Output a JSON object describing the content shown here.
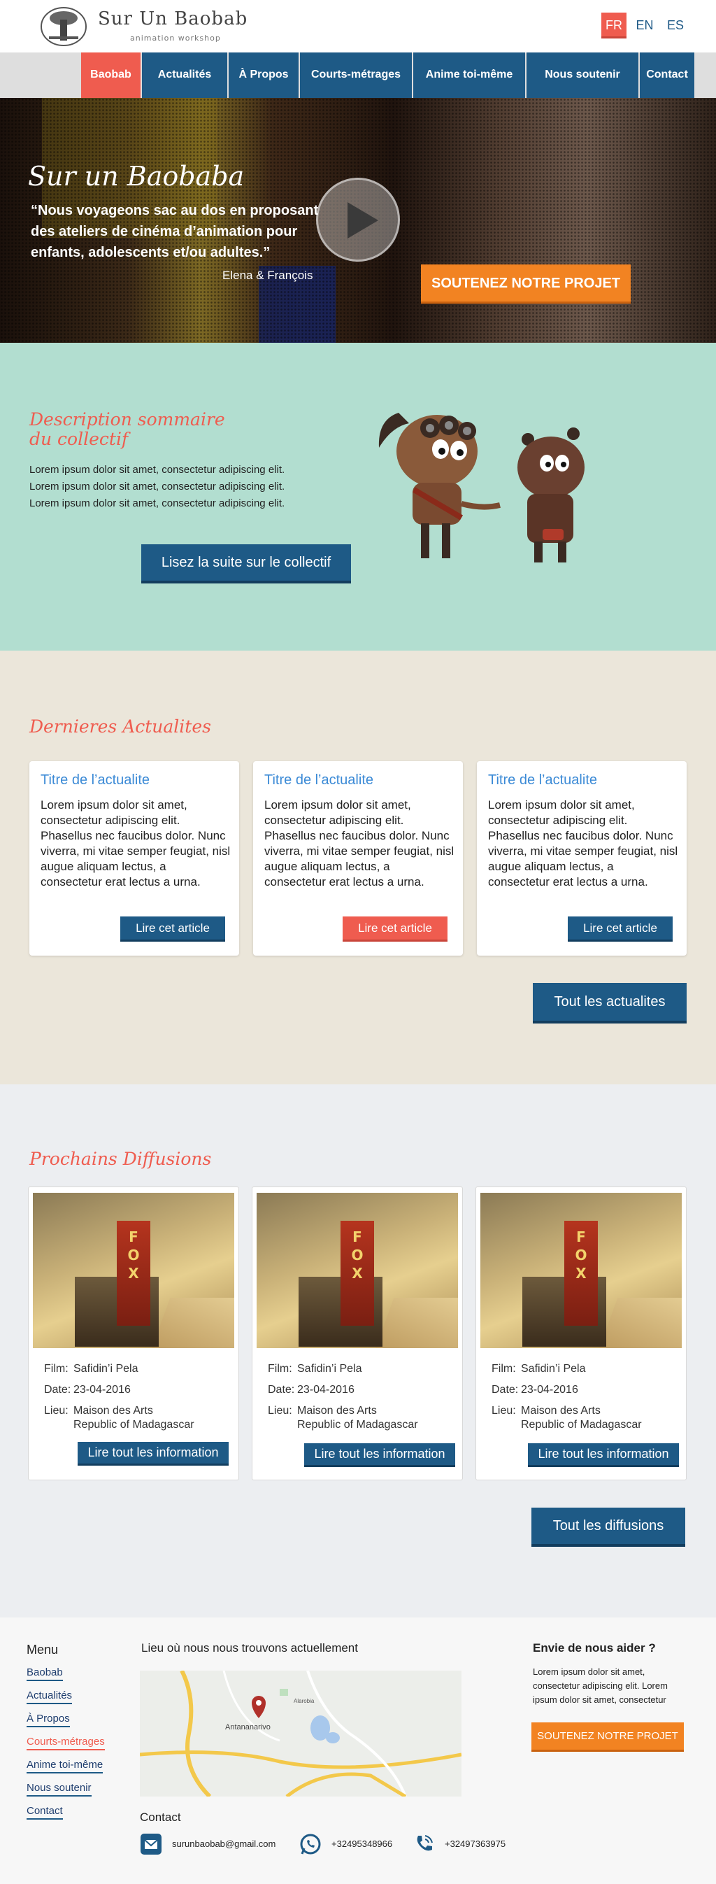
{
  "header": {
    "logo_title": "Sur Un Baobab",
    "logo_subtitle": "animation workshop",
    "languages": [
      "FR",
      "EN",
      "ES"
    ],
    "active_language": "FR"
  },
  "nav": {
    "items": [
      {
        "label": "Baobab"
      },
      {
        "label": "Actualités"
      },
      {
        "label": "À Propos"
      },
      {
        "label": "Courts-métrages"
      },
      {
        "label": "Anime toi-même"
      },
      {
        "label": "Nous soutenir"
      },
      {
        "label": "Contact"
      }
    ],
    "active": "Baobab"
  },
  "hero": {
    "title": "Sur un Baobaba",
    "quote": "“Nous voyageons sac au dos en proposant des ateliers de cinéma d’animation pour enfants, adolescents et/ou adultes.”",
    "author": "Elena & François",
    "cta": "SOUTENEZ NOTRE PROJET"
  },
  "collectif": {
    "title": "Description sommaire du collectif",
    "text": "Lorem ipsum dolor sit amet, consectetur adipiscing elit. Lorem ipsum dolor sit amet, consectetur adipiscing elit. Lorem ipsum dolor sit amet, consectetur adipiscing elit.",
    "button": "Lisez la suite sur le collectif"
  },
  "actualites": {
    "title": "Dernieres Actualites",
    "cards": [
      {
        "title": "Titre de l’actualite",
        "body": "Lorem ipsum dolor sit amet, consectetur adipiscing elit. Phasellus nec faucibus dolor. Nunc viverra, mi vitae semper feugiat, nisl augue aliquam lectus, a consectetur erat lectus a urna.",
        "button": "Lire cet article"
      },
      {
        "title": "Titre de l’actualite",
        "body": "Lorem ipsum dolor sit amet, consectetur adipiscing elit. Phasellus nec faucibus dolor. Nunc viverra, mi vitae semper feugiat, nisl augue aliquam lectus, a consectetur erat lectus a urna.",
        "button": "Lire cet article"
      },
      {
        "title": "Titre de l’actualite",
        "body": "Lorem ipsum dolor sit amet, consectetur adipiscing elit. Phasellus nec faucibus dolor. Nunc viverra, mi vitae semper feugiat, nisl augue aliquam lectus, a consectetur erat lectus a urna.",
        "button": "Lire cet article"
      }
    ],
    "all_button": "Tout les actualites"
  },
  "diffusions": {
    "title": "Prochains Diffusions",
    "labels": {
      "film": "Film:",
      "date": "Date:",
      "lieu": "Lieu:"
    },
    "cards": [
      {
        "image_text": "FOX",
        "film": "Safidin’i Pela",
        "date": "23-04-2016",
        "lieu_line1": "Maison des Arts",
        "lieu_line2": "Republic of Madagascar",
        "button": "Lire tout les information"
      },
      {
        "image_text": "FOX",
        "film": "Safidin’i Pela",
        "date": "23-04-2016",
        "lieu_line1": "Maison des Arts",
        "lieu_line2": "Republic of Madagascar",
        "button": "Lire tout les information"
      },
      {
        "image_text": "FOX",
        "film": "Safidin’i Pela",
        "date": "23-04-2016",
        "lieu_line1": "Maison des Arts",
        "lieu_line2": "Republic of Madagascar",
        "button": "Lire tout les information"
      }
    ],
    "all_button": "Tout les diffusions"
  },
  "footer": {
    "menu_title": "Menu",
    "menu": [
      {
        "label": "Baobab"
      },
      {
        "label": "Actualités"
      },
      {
        "label": "À Propos"
      },
      {
        "label": "Courts-métrages"
      },
      {
        "label": "Anime toi-même"
      },
      {
        "label": "Nous soutenir"
      },
      {
        "label": "Contact"
      }
    ],
    "menu_active": "Courts-métrages",
    "location_title": "Lieu où nous nous trouvons actuellement",
    "map": {
      "city": "Antananarivo",
      "place": "Alarobia"
    },
    "contact_title": "Contact",
    "email": "surunbaobab@gmail.com",
    "whatsapp": "+32495348966",
    "phone": "+32497363975",
    "help_title": "Envie de nous aider ?",
    "help_text": "Lorem ipsum dolor sit amet, consectetur adipiscing elit. Lorem ipsum dolor sit amet, consectetur",
    "help_button": "SOUTENEZ NOTRE PROJET"
  },
  "colors": {
    "primary_blue": "#1e5a86",
    "accent_red": "#ef5c4f",
    "cta_orange": "#f28322",
    "mint": "#b2ded0",
    "beige": "#ebe6da"
  }
}
